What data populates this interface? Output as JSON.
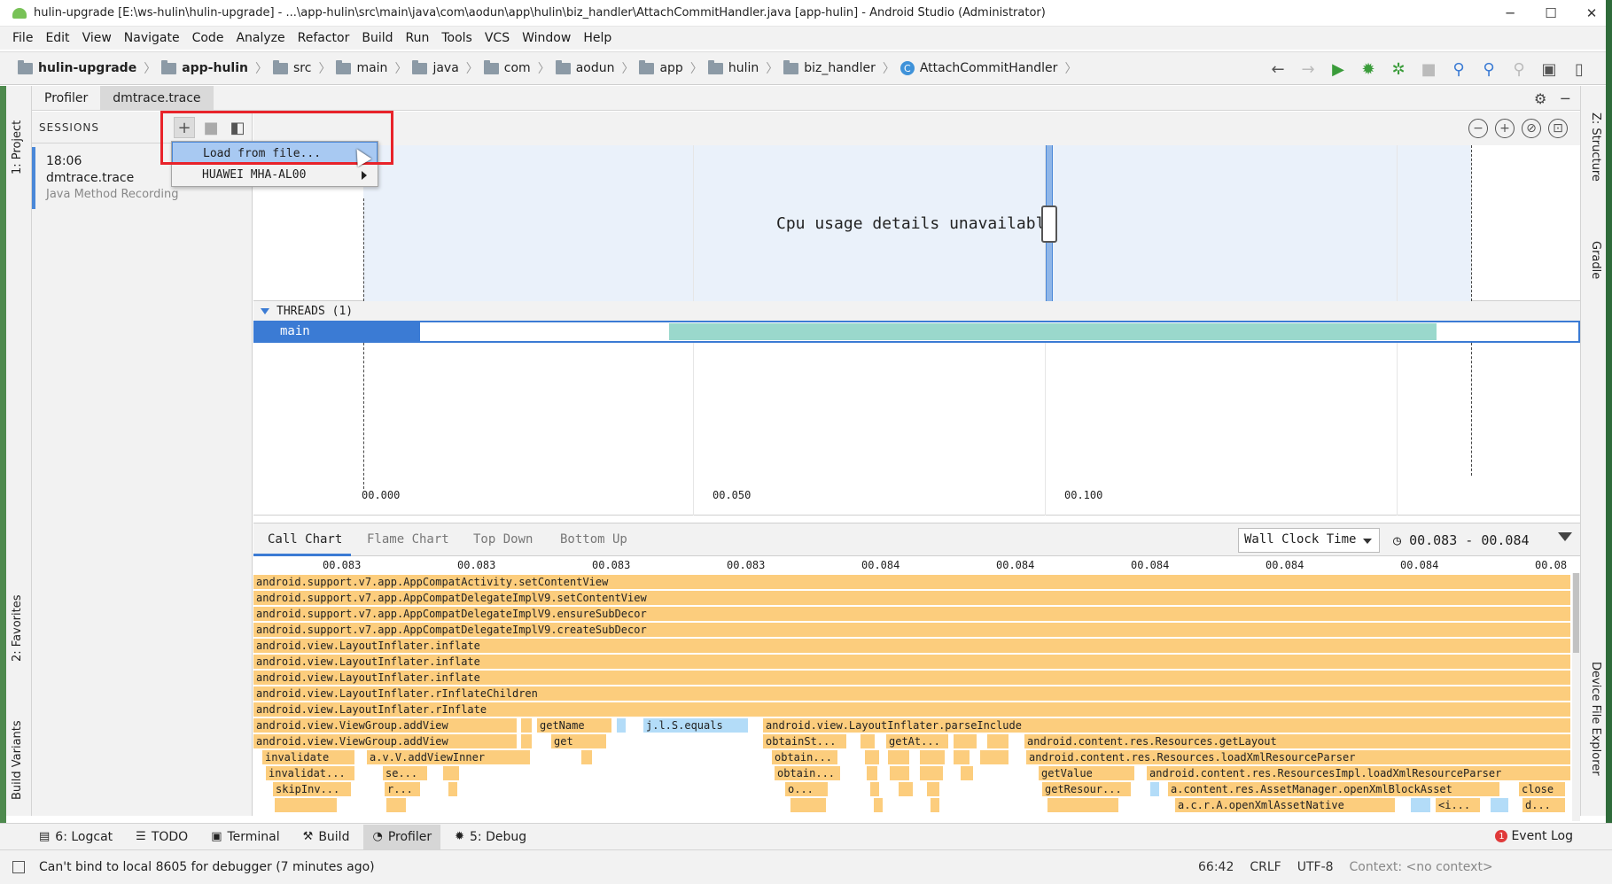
{
  "window": {
    "title": "hulin-upgrade [E:\\ws-hulin\\hulin-upgrade] - ...\\app-hulin\\src\\main\\java\\com\\aodun\\app\\hulin\\biz_handler\\AttachCommitHandler.java [app-hulin] - Android Studio (Administrator)",
    "minimize": "─",
    "maximize": "☐",
    "close": "✕"
  },
  "menu": [
    "File",
    "Edit",
    "View",
    "Navigate",
    "Code",
    "Analyze",
    "Refactor",
    "Build",
    "Run",
    "Tools",
    "VCS",
    "Window",
    "Help"
  ],
  "breadcrumb": [
    "hulin-upgrade",
    "app-hulin",
    "src",
    "main",
    "java",
    "com",
    "aodun",
    "app",
    "hulin",
    "biz_handler",
    "AttachCommitHandler"
  ],
  "side_tabs": {
    "left_top": "1: Project",
    "left_favorites": "2: Favorites",
    "left_variants": "Build Variants",
    "right_structure": "Z: Structure",
    "right_gradle": "Gradle",
    "right_device": "Device File Explorer"
  },
  "profiler_tabs": {
    "profiler": "Profiler",
    "trace": "dmtrace.trace"
  },
  "sessions": {
    "header": "SESSIONS",
    "item": {
      "time": "18:06",
      "name": "dmtrace.trace",
      "kind": "Java Method Recording"
    }
  },
  "popup": {
    "load_from_file": "Load from file...",
    "device": "HUAWEI MHA-AL00"
  },
  "cpu": {
    "message": "Cpu usage details unavailable"
  },
  "threads": {
    "header": "THREADS (1)",
    "main": "main"
  },
  "timeline_ticks": [
    "00.000",
    "00.050",
    "00.100"
  ],
  "analysis": {
    "tabs": [
      "Call Chart",
      "Flame Chart",
      "Top Down",
      "Bottom Up"
    ],
    "clock": "Wall Clock Time",
    "range": "00.083 - 00.084"
  },
  "call_axis": [
    "00.083",
    "00.083",
    "00.083",
    "00.083",
    "00.084",
    "00.084",
    "00.084",
    "00.084",
    "00.084",
    "00.08"
  ],
  "call_rows": [
    "android.support.v7.app.AppCompatActivity.setContentView",
    "android.support.v7.app.AppCompatDelegateImplV9.setContentView",
    "android.support.v7.app.AppCompatDelegateImplV9.ensureSubDecor",
    "android.support.v7.app.AppCompatDelegateImplV9.createSubDecor",
    "android.view.LayoutInflater.inflate",
    "android.view.LayoutInflater.inflate",
    "android.view.LayoutInflater.inflate",
    "android.view.LayoutInflater.rInflateChildren",
    "android.view.LayoutInflater.rInflate"
  ],
  "call_fragments": {
    "r10a": "android.view.ViewGroup.addView",
    "r10b": "getName",
    "r10c": "j.l.S.equals",
    "r10d": "android.view.LayoutInflater.parseInclude",
    "r11a": "android.view.ViewGroup.addView",
    "r11b": "get",
    "r11c": "obtainSt...",
    "r11d": "getAt...",
    "r11e": "android.content.res.Resources.getLayout",
    "r12a": "invalidate",
    "r12b": "a.v.V.addViewInner",
    "r12c": "obtain...",
    "r12d": "android.content.res.Resources.loadXmlResourceParser",
    "r13a": "invalidat...",
    "r13b": "se...",
    "r13c": "obtain...",
    "r13d": "getValue",
    "r13e": "android.content.res.ResourcesImpl.loadXmlResourceParser",
    "r14a": "skipInv...",
    "r14b": "r...",
    "r14c": "o...",
    "r14d": "getResour...",
    "r14e": "a.content.res.AssetManager.openXmlBlockAsset",
    "r14f": "close",
    "r15a": "a.c.r.A.openXmlAssetNative",
    "r15b": "<i...",
    "r15c": "d..."
  },
  "bottom_tools": {
    "logcat": "6: Logcat",
    "todo": "TODO",
    "terminal": "Terminal",
    "build": "Build",
    "profiler": "Profiler",
    "debug": "5: Debug",
    "event_log": "Event Log",
    "event_count": "1"
  },
  "status": {
    "message": "Can't bind to local 8605 for debugger (7 minutes ago)",
    "position": "66:42",
    "line_sep": "CRLF",
    "encoding": "UTF-8",
    "context": "Context: <no context>"
  },
  "colors": {
    "accent": "#3b7bd4",
    "call_bar": "#fccd7d",
    "highlight": "#e8232a",
    "thread_activity": "#9ad8cc"
  }
}
